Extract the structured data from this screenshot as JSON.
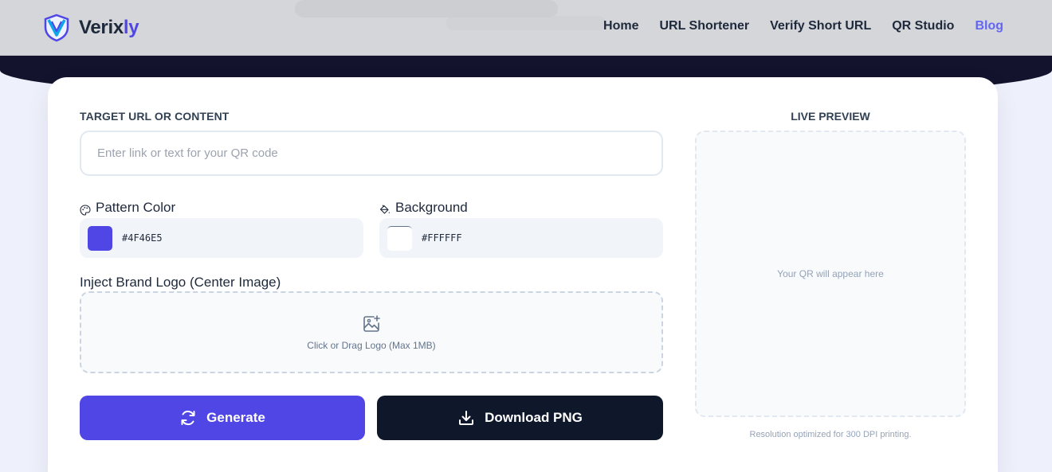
{
  "brand": {
    "name_main": "Verix",
    "name_accent": "ly",
    "accent_color": "#4f46e5"
  },
  "nav": [
    {
      "label": "Home"
    },
    {
      "label": "URL Shortener"
    },
    {
      "label": "Verify Short URL"
    },
    {
      "label": "QR Studio"
    },
    {
      "label": "Blog"
    }
  ],
  "form": {
    "target_label": "TARGET URL OR CONTENT",
    "target_placeholder": "Enter link or text for your QR code",
    "target_value": "",
    "pattern_color": {
      "label": "Pattern Color",
      "value": "#4F46E5",
      "icon": "palette-icon"
    },
    "background_color": {
      "label": "Background",
      "value": "#FFFFFF",
      "icon": "paint-bucket-icon"
    },
    "logo_label": "Inject Brand Logo (Center Image)",
    "logo_dropzone_text": "Click or Drag Logo (Max 1MB)",
    "logo_icon": "image-plus-icon"
  },
  "actions": {
    "generate_label": "Generate",
    "generate_icon": "refresh-icon",
    "download_label": "Download PNG",
    "download_icon": "download-icon"
  },
  "preview": {
    "title": "LIVE PREVIEW",
    "placeholder": "Your QR will appear here",
    "note": "Resolution optimized for 300 DPI printing."
  },
  "colors": {
    "primary": "#4f46e5",
    "dark": "#0f172a",
    "hero": "#13132e",
    "page_bg": "#eef0fb"
  }
}
